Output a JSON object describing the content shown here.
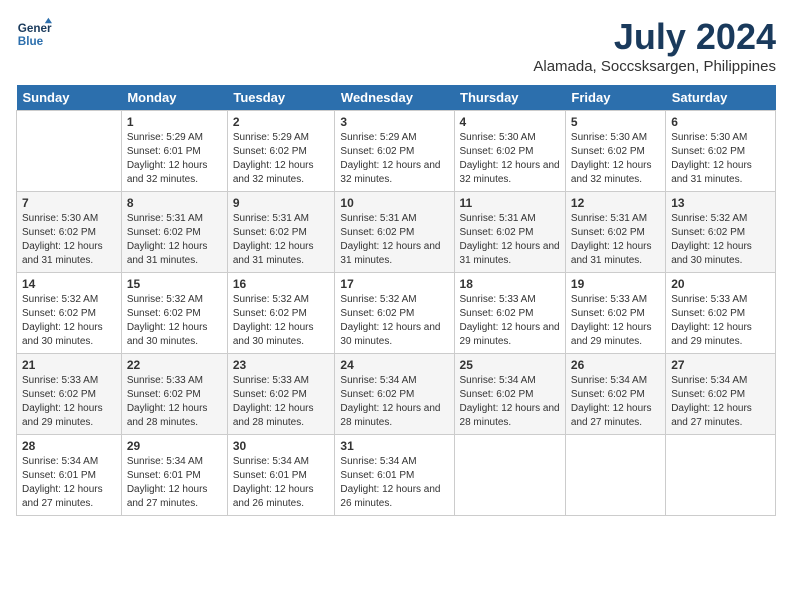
{
  "logo": {
    "line1": "General",
    "line2": "Blue"
  },
  "title": "July 2024",
  "subtitle": "Alamada, Soccsksargen, Philippines",
  "days_of_week": [
    "Sunday",
    "Monday",
    "Tuesday",
    "Wednesday",
    "Thursday",
    "Friday",
    "Saturday"
  ],
  "weeks": [
    [
      {
        "day": "",
        "sunrise": "",
        "sunset": "",
        "daylight": ""
      },
      {
        "day": "1",
        "sunrise": "Sunrise: 5:29 AM",
        "sunset": "Sunset: 6:01 PM",
        "daylight": "Daylight: 12 hours and 32 minutes."
      },
      {
        "day": "2",
        "sunrise": "Sunrise: 5:29 AM",
        "sunset": "Sunset: 6:02 PM",
        "daylight": "Daylight: 12 hours and 32 minutes."
      },
      {
        "day": "3",
        "sunrise": "Sunrise: 5:29 AM",
        "sunset": "Sunset: 6:02 PM",
        "daylight": "Daylight: 12 hours and 32 minutes."
      },
      {
        "day": "4",
        "sunrise": "Sunrise: 5:30 AM",
        "sunset": "Sunset: 6:02 PM",
        "daylight": "Daylight: 12 hours and 32 minutes."
      },
      {
        "day": "5",
        "sunrise": "Sunrise: 5:30 AM",
        "sunset": "Sunset: 6:02 PM",
        "daylight": "Daylight: 12 hours and 32 minutes."
      },
      {
        "day": "6",
        "sunrise": "Sunrise: 5:30 AM",
        "sunset": "Sunset: 6:02 PM",
        "daylight": "Daylight: 12 hours and 31 minutes."
      }
    ],
    [
      {
        "day": "7",
        "sunrise": "Sunrise: 5:30 AM",
        "sunset": "Sunset: 6:02 PM",
        "daylight": "Daylight: 12 hours and 31 minutes."
      },
      {
        "day": "8",
        "sunrise": "Sunrise: 5:31 AM",
        "sunset": "Sunset: 6:02 PM",
        "daylight": "Daylight: 12 hours and 31 minutes."
      },
      {
        "day": "9",
        "sunrise": "Sunrise: 5:31 AM",
        "sunset": "Sunset: 6:02 PM",
        "daylight": "Daylight: 12 hours and 31 minutes."
      },
      {
        "day": "10",
        "sunrise": "Sunrise: 5:31 AM",
        "sunset": "Sunset: 6:02 PM",
        "daylight": "Daylight: 12 hours and 31 minutes."
      },
      {
        "day": "11",
        "sunrise": "Sunrise: 5:31 AM",
        "sunset": "Sunset: 6:02 PM",
        "daylight": "Daylight: 12 hours and 31 minutes."
      },
      {
        "day": "12",
        "sunrise": "Sunrise: 5:31 AM",
        "sunset": "Sunset: 6:02 PM",
        "daylight": "Daylight: 12 hours and 31 minutes."
      },
      {
        "day": "13",
        "sunrise": "Sunrise: 5:32 AM",
        "sunset": "Sunset: 6:02 PM",
        "daylight": "Daylight: 12 hours and 30 minutes."
      }
    ],
    [
      {
        "day": "14",
        "sunrise": "Sunrise: 5:32 AM",
        "sunset": "Sunset: 6:02 PM",
        "daylight": "Daylight: 12 hours and 30 minutes."
      },
      {
        "day": "15",
        "sunrise": "Sunrise: 5:32 AM",
        "sunset": "Sunset: 6:02 PM",
        "daylight": "Daylight: 12 hours and 30 minutes."
      },
      {
        "day": "16",
        "sunrise": "Sunrise: 5:32 AM",
        "sunset": "Sunset: 6:02 PM",
        "daylight": "Daylight: 12 hours and 30 minutes."
      },
      {
        "day": "17",
        "sunrise": "Sunrise: 5:32 AM",
        "sunset": "Sunset: 6:02 PM",
        "daylight": "Daylight: 12 hours and 30 minutes."
      },
      {
        "day": "18",
        "sunrise": "Sunrise: 5:33 AM",
        "sunset": "Sunset: 6:02 PM",
        "daylight": "Daylight: 12 hours and 29 minutes."
      },
      {
        "day": "19",
        "sunrise": "Sunrise: 5:33 AM",
        "sunset": "Sunset: 6:02 PM",
        "daylight": "Daylight: 12 hours and 29 minutes."
      },
      {
        "day": "20",
        "sunrise": "Sunrise: 5:33 AM",
        "sunset": "Sunset: 6:02 PM",
        "daylight": "Daylight: 12 hours and 29 minutes."
      }
    ],
    [
      {
        "day": "21",
        "sunrise": "Sunrise: 5:33 AM",
        "sunset": "Sunset: 6:02 PM",
        "daylight": "Daylight: 12 hours and 29 minutes."
      },
      {
        "day": "22",
        "sunrise": "Sunrise: 5:33 AM",
        "sunset": "Sunset: 6:02 PM",
        "daylight": "Daylight: 12 hours and 28 minutes."
      },
      {
        "day": "23",
        "sunrise": "Sunrise: 5:33 AM",
        "sunset": "Sunset: 6:02 PM",
        "daylight": "Daylight: 12 hours and 28 minutes."
      },
      {
        "day": "24",
        "sunrise": "Sunrise: 5:34 AM",
        "sunset": "Sunset: 6:02 PM",
        "daylight": "Daylight: 12 hours and 28 minutes."
      },
      {
        "day": "25",
        "sunrise": "Sunrise: 5:34 AM",
        "sunset": "Sunset: 6:02 PM",
        "daylight": "Daylight: 12 hours and 28 minutes."
      },
      {
        "day": "26",
        "sunrise": "Sunrise: 5:34 AM",
        "sunset": "Sunset: 6:02 PM",
        "daylight": "Daylight: 12 hours and 27 minutes."
      },
      {
        "day": "27",
        "sunrise": "Sunrise: 5:34 AM",
        "sunset": "Sunset: 6:02 PM",
        "daylight": "Daylight: 12 hours and 27 minutes."
      }
    ],
    [
      {
        "day": "28",
        "sunrise": "Sunrise: 5:34 AM",
        "sunset": "Sunset: 6:01 PM",
        "daylight": "Daylight: 12 hours and 27 minutes."
      },
      {
        "day": "29",
        "sunrise": "Sunrise: 5:34 AM",
        "sunset": "Sunset: 6:01 PM",
        "daylight": "Daylight: 12 hours and 27 minutes."
      },
      {
        "day": "30",
        "sunrise": "Sunrise: 5:34 AM",
        "sunset": "Sunset: 6:01 PM",
        "daylight": "Daylight: 12 hours and 26 minutes."
      },
      {
        "day": "31",
        "sunrise": "Sunrise: 5:34 AM",
        "sunset": "Sunset: 6:01 PM",
        "daylight": "Daylight: 12 hours and 26 minutes."
      },
      {
        "day": "",
        "sunrise": "",
        "sunset": "",
        "daylight": ""
      },
      {
        "day": "",
        "sunrise": "",
        "sunset": "",
        "daylight": ""
      },
      {
        "day": "",
        "sunrise": "",
        "sunset": "",
        "daylight": ""
      }
    ]
  ]
}
